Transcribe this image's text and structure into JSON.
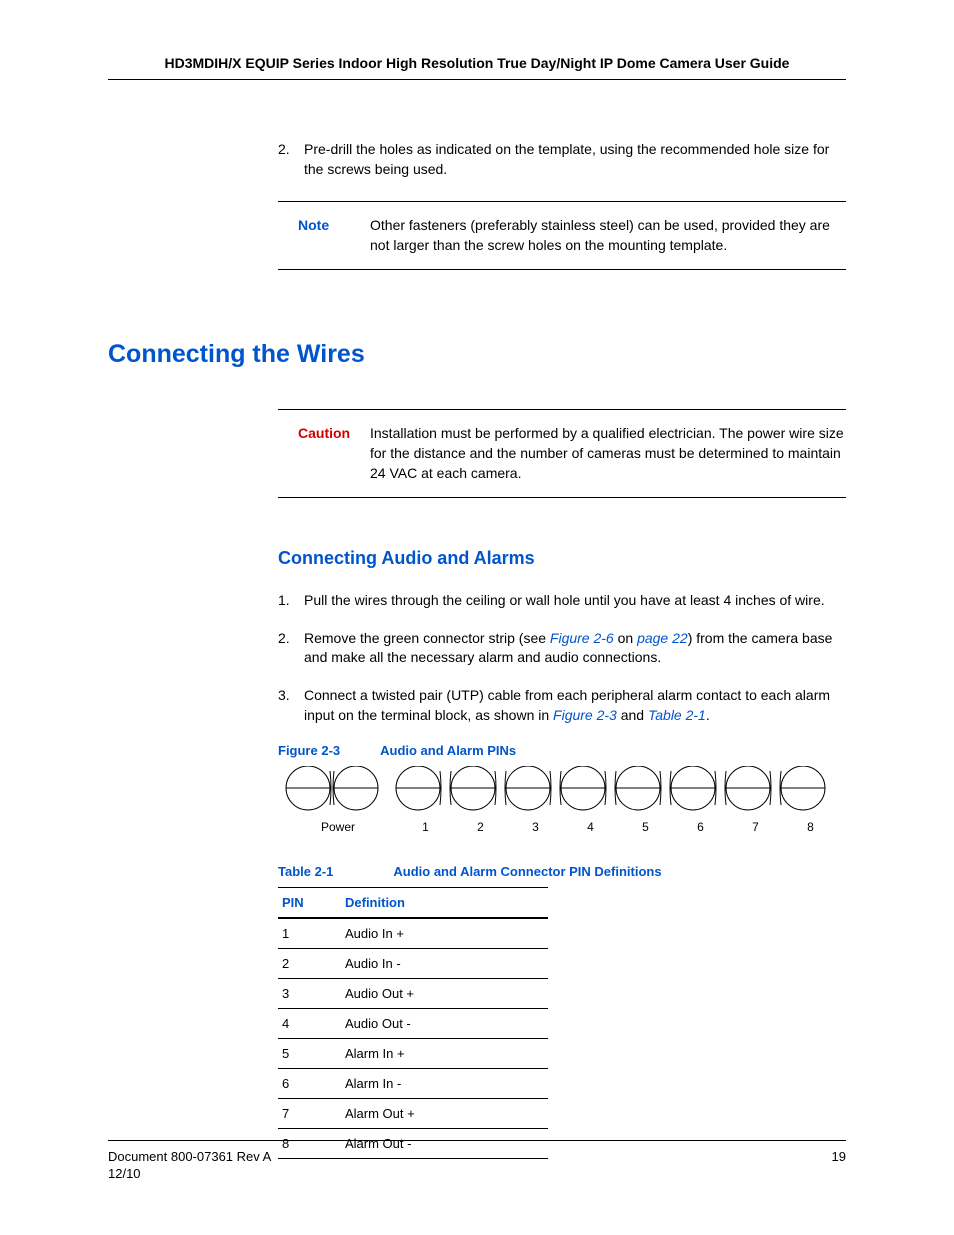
{
  "header": "HD3MDIH/X EQUIP Series Indoor High Resolution True Day/Night IP Dome Camera User Guide",
  "step2": {
    "num": "2.",
    "text": "Pre-drill the holes as indicated on the template, using the recommended hole size for the screws being used."
  },
  "note": {
    "label": "Note",
    "text": "Other fasteners (preferably stainless steel) can be used, provided they are not larger than the screw holes on the mounting template."
  },
  "h1": "Connecting the Wires",
  "caution": {
    "label": "Caution",
    "text": "Installation must be performed by a qualified electrician. The power wire size for the distance and the number of cameras must be determined to maintain 24 VAC at each camera."
  },
  "h2": "Connecting Audio and Alarms",
  "steps": [
    {
      "num": "1.",
      "text": "Pull the wires through the ceiling or wall hole until you have at least 4 inches of wire."
    },
    {
      "num": "2.",
      "pre": "Remove the green connector strip (see ",
      "link1": "Figure 2-6",
      "mid1": " on ",
      "link2": "page 22",
      "post": ") from the camera base and make all the necessary alarm and audio connections."
    },
    {
      "num": "3.",
      "pre": "Connect a twisted pair (UTP) cable from each peripheral alarm contact to each alarm input on the terminal block, as shown in ",
      "link1": "Figure 2-3",
      "mid1": " and ",
      "link2": "Table 2-1",
      "post": "."
    }
  ],
  "figure": {
    "num": "Figure 2-3",
    "title": "Audio and Alarm PINs",
    "powerLabel": "Power",
    "pinNums": [
      "1",
      "2",
      "3",
      "4",
      "5",
      "6",
      "7",
      "8"
    ]
  },
  "table": {
    "num": "Table 2-1",
    "title": "Audio and Alarm Connector PIN Definitions",
    "headers": {
      "pin": "PIN",
      "def": "Definition"
    },
    "rows": [
      {
        "pin": "1",
        "def": "Audio In +"
      },
      {
        "pin": "2",
        "def": "Audio In -"
      },
      {
        "pin": "3",
        "def": "Audio Out +"
      },
      {
        "pin": "4",
        "def": "Audio Out -"
      },
      {
        "pin": "5",
        "def": "Alarm In +"
      },
      {
        "pin": "6",
        "def": "Alarm In -"
      },
      {
        "pin": "7",
        "def": "Alarm Out +"
      },
      {
        "pin": "8",
        "def": "Alarm Out -"
      }
    ]
  },
  "footer": {
    "doc": "Document 800-07361 Rev A",
    "date": "12/10",
    "page": "19"
  }
}
